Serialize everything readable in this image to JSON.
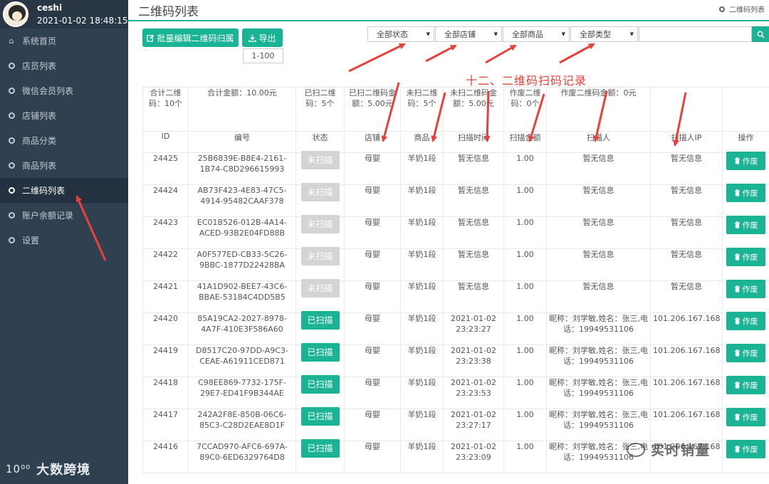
{
  "user": {
    "name": "ceshi",
    "datetime": "2021-01-02 18:48:15"
  },
  "sidebar": {
    "items": [
      {
        "label": "系统首页",
        "icon": "home-icon"
      },
      {
        "label": "店员列表",
        "icon": "circle-icon"
      },
      {
        "label": "微信会员列表",
        "icon": "circle-icon"
      },
      {
        "label": "店铺列表",
        "icon": "circle-icon"
      },
      {
        "label": "商品分类",
        "icon": "circle-icon"
      },
      {
        "label": "商品列表",
        "icon": "circle-icon"
      },
      {
        "label": "二维码列表",
        "icon": "circle-icon",
        "active": true
      },
      {
        "label": "账户余额记录",
        "icon": "circle-icon"
      },
      {
        "label": "设置",
        "icon": "circle-icon"
      }
    ],
    "watermark": "大数跨境",
    "watermark_mark": "10⁰⁰"
  },
  "header": {
    "title": "二维码列表",
    "breadcrumb": "二维码列表"
  },
  "toolbar": {
    "batch_label": "批量编辑二维码归属",
    "export_label": "导出",
    "range_label": "1-100",
    "filters": [
      "全部状态",
      "全部店铺",
      "全部商品",
      "全部类型"
    ],
    "search_placeholder": ""
  },
  "annotation": "十二、二维码扫码记录",
  "summary": {
    "total_codes": "合计二维码：10个",
    "total_amount": "合计金额：10.00元",
    "scanned_codes": "已扫二维码：5个",
    "scanned_amount": "已扫二维码金额：5.00元",
    "unscanned_codes": "未扫二维码：5个",
    "unscanned_amount": "未扫二维码金额：5.00元",
    "void_codes": "作废二维码：0个",
    "void_amount": "作废二维码金额：0元"
  },
  "columns": [
    "ID",
    "编号",
    "状态",
    "店铺",
    "商品",
    "扫描时间",
    "扫描金额",
    "扫描人",
    "扫描人IP",
    "操作"
  ],
  "void_label": "作废",
  "rows": [
    {
      "id": "24425",
      "code": "25B6839E-B8E4-2161-1B74-C8D296615993",
      "status": "未扫描",
      "scanned": false,
      "shop": "母婴",
      "product": "羊奶1段",
      "time": "暂无信息",
      "amount": "1.00",
      "scanner": "暂无信息",
      "ip": "暂无信息"
    },
    {
      "id": "24424",
      "code": "AB73F423-4E83-47C5-4914-95482CAAF378",
      "status": "未扫描",
      "scanned": false,
      "shop": "母婴",
      "product": "羊奶1段",
      "time": "暂无信息",
      "amount": "1.00",
      "scanner": "暂无信息",
      "ip": "暂无信息"
    },
    {
      "id": "24423",
      "code": "EC01B526-012B-4A14-ACED-93B2E04FD88B",
      "status": "未扫描",
      "scanned": false,
      "shop": "母婴",
      "product": "羊奶1段",
      "time": "暂无信息",
      "amount": "1.00",
      "scanner": "暂无信息",
      "ip": "暂无信息"
    },
    {
      "id": "24422",
      "code": "A0F577ED-CB33-5C26-9BBC-1877D22428BA",
      "status": "未扫描",
      "scanned": false,
      "shop": "母婴",
      "product": "羊奶1段",
      "time": "暂无信息",
      "amount": "1.00",
      "scanner": "暂无信息",
      "ip": "暂无信息"
    },
    {
      "id": "24421",
      "code": "41A1D902-BEE7-43C6-BBAE-53184C4DD5B5",
      "status": "未扫描",
      "scanned": false,
      "shop": "母婴",
      "product": "羊奶1段",
      "time": "暂无信息",
      "amount": "1.00",
      "scanner": "暂无信息",
      "ip": "暂无信息"
    },
    {
      "id": "24420",
      "code": "85A19CA2-2027-8978-4A7F-410E3F586A60",
      "status": "已扫描",
      "scanned": true,
      "shop": "母婴",
      "product": "羊奶1段",
      "time": "2021-01-02 23:23:27",
      "amount": "1.00",
      "scanner": "昵称：刘学敏,姓名：张三,电话：19949531106",
      "ip": "101.206.167.168"
    },
    {
      "id": "24419",
      "code": "D8517C20-97DD-A9C3-CEAE-A61911CED871",
      "status": "已扫描",
      "scanned": true,
      "shop": "母婴",
      "product": "羊奶1段",
      "time": "2021-01-02 23:23:38",
      "amount": "1.00",
      "scanner": "昵称：刘学敏,姓名：张三,电话：19949531106",
      "ip": "101.206.167.168"
    },
    {
      "id": "24418",
      "code": "C98EE869-7732-175F-29E7-ED41F9B344AE",
      "status": "已扫描",
      "scanned": true,
      "shop": "母婴",
      "product": "羊奶1段",
      "time": "2021-01-02 23:23:53",
      "amount": "1.00",
      "scanner": "昵称：刘学敏,姓名：张三,电话：19949531106",
      "ip": "101.206.167.168"
    },
    {
      "id": "24417",
      "code": "242A2F8E-850B-06C6-85C3-C28D2EAE8D1F",
      "status": "已扫描",
      "scanned": true,
      "shop": "母婴",
      "product": "羊奶1段",
      "time": "2021-01-02 23:27:17",
      "amount": "1.00",
      "scanner": "昵称：刘学敏,姓名：张三,电话：19949531106",
      "ip": "101.206.167.168"
    },
    {
      "id": "24416",
      "code": "7CCAD970-AFC6-697A-89C0-6ED6329764D8",
      "status": "已扫描",
      "scanned": true,
      "shop": "母婴",
      "product": "羊奶1段",
      "time": "2021-01-02 23:23:09",
      "amount": "1.00",
      "scanner": "昵称：刘学敏,姓名：张三,电话：19949531106",
      "ip": "101.206.167.168"
    }
  ],
  "watermark": "实时销量",
  "colors": {
    "sidebar": "#2f4050",
    "accent": "#1ab394",
    "annotation": "#e8403a",
    "disabled": "#d4d4d4"
  }
}
